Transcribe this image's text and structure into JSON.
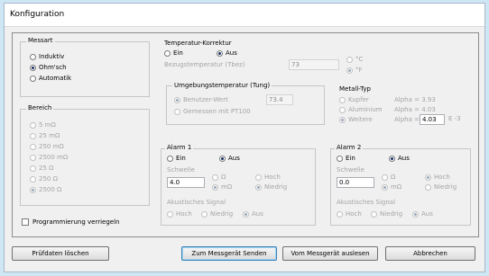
{
  "window": {
    "title": "Konfiguration"
  },
  "messart": {
    "title": "Messart",
    "options": [
      "Induktiv",
      "Ohm'sch",
      "Automatik"
    ]
  },
  "bereich": {
    "title": "Bereich",
    "options": [
      "5 mΩ",
      "25 mΩ",
      "250 mΩ",
      "2500 mΩ",
      "25 Ω",
      "250 Ω",
      "2500 Ω"
    ]
  },
  "programming_lock": {
    "label": "Programmierung verriegeln"
  },
  "temp_correction": {
    "title": "Temperatur-Korrektur",
    "on_label": "Ein",
    "off_label": "Aus",
    "ref_label": "Bezugstemperatur (Tbez)",
    "ref_value": "73",
    "unit_c": "°C",
    "unit_f": "°F",
    "ambient": {
      "title": "Umgebungstemperatur (Tung)",
      "user_label": "Benutzer-Wert",
      "user_value": "73.4",
      "measured_label": "Gemessen mit PT100"
    },
    "metal": {
      "title": "Metall-Typ",
      "items": [
        {
          "label": "Kupfer",
          "alpha": "Alpha = 3.93"
        },
        {
          "label": "Aluminium",
          "alpha": "Alpha = 4.03"
        },
        {
          "label": "Weitere",
          "alpha": "Alpha ="
        }
      ],
      "other_value": "4.03",
      "exponent_label": "E -3"
    }
  },
  "alarm1": {
    "title": "Alarm 1",
    "on_label": "Ein",
    "off_label": "Aus",
    "threshold_label": "Schwelle",
    "threshold_value": "4.0",
    "unit_ohm": "Ω",
    "unit_mohm": "mΩ",
    "high_label": "Hoch",
    "low_label": "Niedrig",
    "acoustic_label": "Akustisches Signal",
    "acoustic_options": [
      "Hoch",
      "Niedrig",
      "Aus"
    ]
  },
  "alarm2": {
    "title": "Alarm 2",
    "on_label": "Ein",
    "off_label": "Aus",
    "threshold_label": "Schwelle",
    "threshold_value": "0.0",
    "unit_ohm": "Ω",
    "unit_mohm": "mΩ",
    "high_label": "Hoch",
    "low_label": "Niedrig",
    "acoustic_label": "Akustisches Signal",
    "acoustic_options": [
      "Hoch",
      "Niedrig",
      "Aus"
    ]
  },
  "buttons": {
    "clear": "Prüfdaten löschen",
    "send": "Zum Messgerät Senden",
    "read": "Vom Messgerät auslesen",
    "cancel": "Abbrechen"
  }
}
